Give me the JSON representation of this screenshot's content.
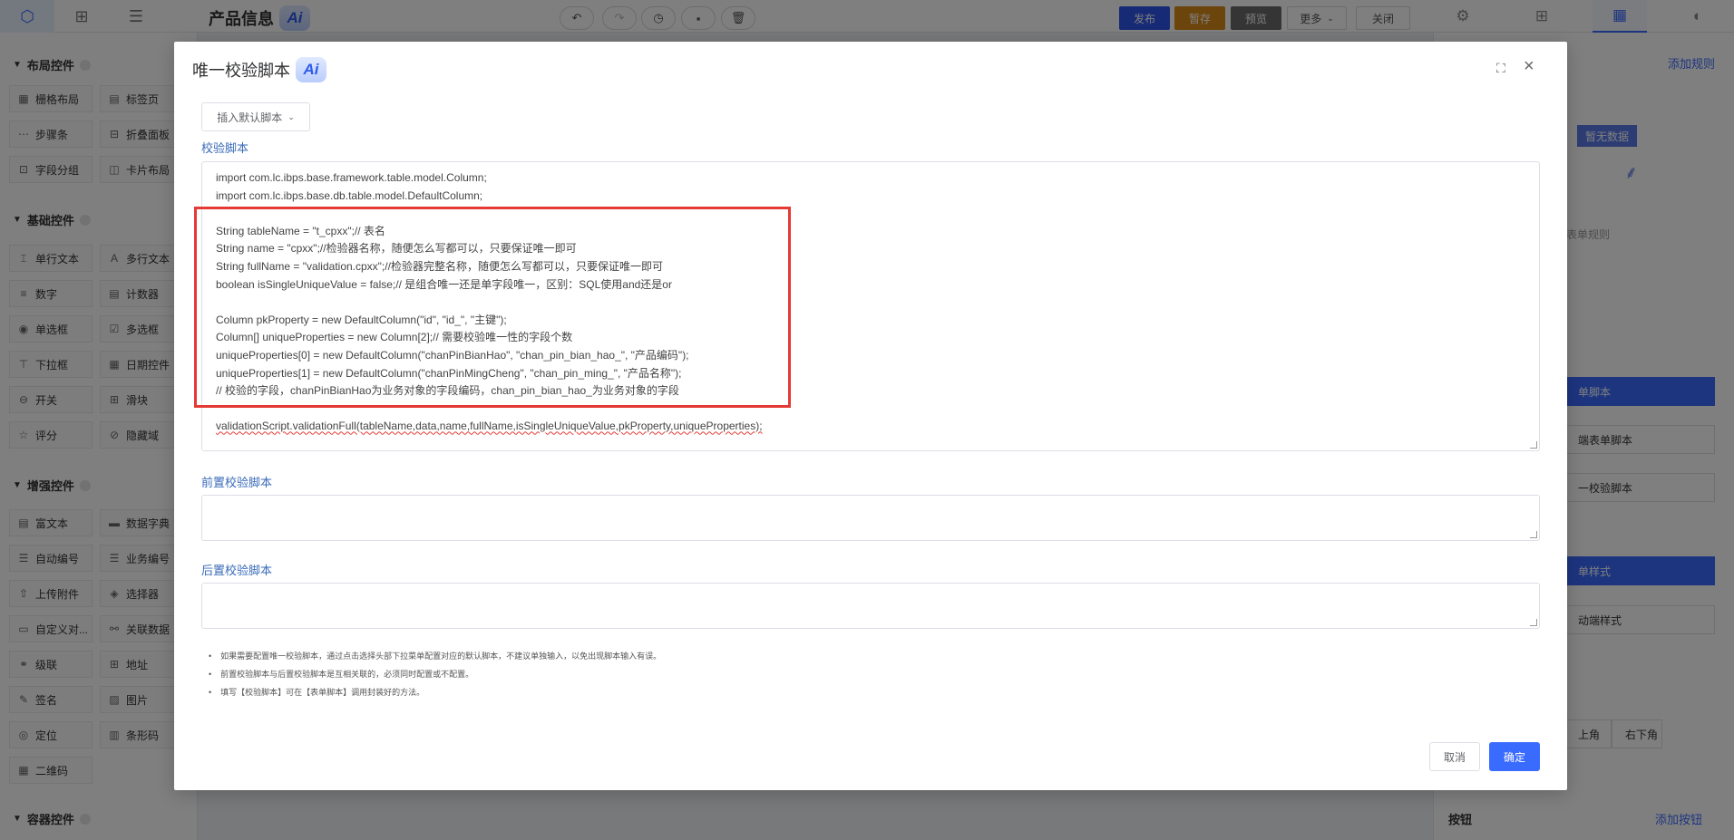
{
  "app": {
    "title": "产品信息",
    "ai_badge": "Ai",
    "publish": "发布",
    "save_draft": "暂存",
    "preview": "预览",
    "more": "更多",
    "close": "关闭"
  },
  "left_panel": {
    "sections": [
      {
        "title": "布局控件",
        "items": [
          "栅格布局",
          "标签页",
          "步骤条",
          "折叠面板",
          "字段分组",
          "卡片布局"
        ]
      },
      {
        "title": "基础控件",
        "items": [
          "单行文本",
          "多行文本",
          "数字",
          "计数器",
          "单选框",
          "多选框",
          "下拉框",
          "日期控件",
          "开关",
          "滑块",
          "评分",
          "隐藏域"
        ]
      },
      {
        "title": "增强控件",
        "items": [
          "富文本",
          "数据字典",
          "自动编号",
          "业务编号",
          "上传附件",
          "选择器",
          "自定义对...",
          "关联数据",
          "级联",
          "地址",
          "签名",
          "图片",
          "定位",
          "条形码",
          "二维码"
        ]
      },
      {
        "title": "容器控件",
        "items": []
      }
    ]
  },
  "right_panel": {
    "add_rule": "添加规则",
    "no_data": "暂无数据",
    "form_rule_text": "表单规则",
    "btn_form_script": "单脚本",
    "btn_mobile_script": "端表单脚本",
    "btn_unique_script": "一校验脚本",
    "btn_form_style": "单样式",
    "btn_mobile_style": "动端样式",
    "pos_upper_left": "上角",
    "pos_lower_right": "右下角",
    "buttons_label": "按钮",
    "add_button": "添加按钮"
  },
  "dialog": {
    "title": "唯一校验脚本",
    "ai_badge": "Ai",
    "insert_default": "插入默认脚本",
    "script_label": "校验脚本",
    "code_lines": [
      "import com.lc.ibps.base.framework.table.model.Column;",
      "import com.lc.ibps.base.db.table.model.DefaultColumn;",
      "",
      "String tableName = \"t_cpxx\";// 表名",
      "String name = \"cpxx\";//检验器名称，随便怎么写都可以，只要保证唯一即可",
      "String fullName = \"validation.cpxx\";//检验器完整名称，随便怎么写都可以，只要保证唯一即可",
      "boolean isSingleUniqueValue = false;// 是组合唯一还是单字段唯一，区别：SQL使用and还是or",
      "",
      "Column pkProperty = new DefaultColumn(\"id\", \"id_\", \"主键\");",
      "Column[] uniqueProperties = new Column[2];// 需要校验唯一性的字段个数",
      "uniqueProperties[0] = new DefaultColumn(\"chanPinBianHao\", \"chan_pin_bian_hao_\", \"产品编码\");",
      "uniqueProperties[1] = new DefaultColumn(\"chanPinMingCheng\", \"chan_pin_ming_\", \"产品名称\");",
      "// 校验的字段，chanPinBianHao为业务对象的字段编码，chan_pin_bian_hao_为业务对象的字段",
      "",
      "validationScript.validationFull(tableName,data,name,fullName,isSingleUniqueValue,pkProperty,uniqueProperties);"
    ],
    "pre_script_label": "前置校验脚本",
    "post_script_label": "后置校验脚本",
    "tips": [
      "如果需要配置唯一校验脚本，通过点击选择头部下拉菜单配置对应的默认脚本，不建议单独输入，以免出现脚本输入有误。",
      "前置校验脚本与后置校验脚本是互相关联的，必须同时配置或不配置。",
      "填写【校验脚本】可在【表单脚本】调用封装好的方法。"
    ],
    "cancel": "取消",
    "confirm": "确定"
  },
  "colors": {
    "primary": "#3a6bff",
    "publish": "#2f54eb",
    "draft": "#d98b1a",
    "preview": "#6b6b6b",
    "highlight": "#e53935"
  }
}
